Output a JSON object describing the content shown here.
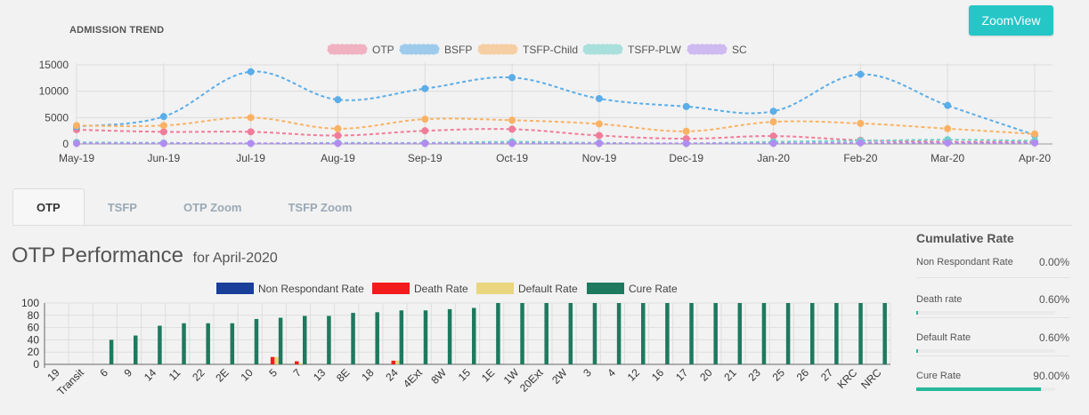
{
  "header": {
    "trend_title": "ADMISSION TREND",
    "zoom_button": "ZoomView"
  },
  "chart_data": [
    {
      "type": "line",
      "title": "ADMISSION TREND",
      "categories": [
        "May-19",
        "Jun-19",
        "Jul-19",
        "Aug-19",
        "Sep-19",
        "Oct-19",
        "Nov-19",
        "Dec-19",
        "Jan-20",
        "Feb-20",
        "Mar-20",
        "Apr-20"
      ],
      "ylim": [
        0,
        15000
      ],
      "yticks": [
        0,
        5000,
        10000,
        15000
      ],
      "legend_position": "top",
      "grid": true,
      "series": [
        {
          "name": "OTP",
          "color": "#f07c9a",
          "values": [
            2700,
            2300,
            2300,
            1600,
            2500,
            2800,
            1600,
            1000,
            1500,
            700,
            400,
            400
          ]
        },
        {
          "name": "BSFP",
          "color": "#5aade8",
          "values": [
            3300,
            5200,
            13700,
            8400,
            10500,
            12600,
            8600,
            7100,
            6200,
            13200,
            7300,
            1700
          ]
        },
        {
          "name": "TSFP-Child",
          "color": "#f9b264",
          "values": [
            3500,
            3500,
            5000,
            2900,
            4700,
            4500,
            3800,
            2400,
            4200,
            3900,
            2900,
            1900
          ]
        },
        {
          "name": "TSFP-PLW",
          "color": "#6fd0cb",
          "values": [
            300,
            200,
            100,
            200,
            200,
            400,
            200,
            100,
            400,
            600,
            800,
            600
          ]
        },
        {
          "name": "SC",
          "color": "#b18cf0",
          "values": [
            100,
            100,
            100,
            100,
            100,
            100,
            100,
            100,
            100,
            200,
            200,
            200
          ]
        }
      ]
    },
    {
      "type": "bar",
      "categories": [
        "19",
        "Transit",
        "6",
        "9",
        "14",
        "11",
        "22",
        "2E",
        "10",
        "5",
        "7",
        "13",
        "8E",
        "18",
        "24",
        "4Ext",
        "8W",
        "15",
        "1E",
        "1W",
        "20Ext",
        "2W",
        "3",
        "4",
        "12",
        "16",
        "17",
        "20",
        "21",
        "23",
        "25",
        "26",
        "27",
        "KRC",
        "NRC"
      ],
      "ylim": [
        0,
        100
      ],
      "yticks": [
        0,
        20,
        40,
        60,
        80,
        100
      ],
      "legend_position": "top",
      "series": [
        {
          "name": "Non Respondant Rate",
          "color": "#1a3f9a",
          "values": [
            0,
            0,
            0,
            0,
            0,
            0,
            0,
            0,
            0,
            0,
            0,
            0,
            0,
            0,
            0,
            0,
            0,
            0,
            0,
            0,
            0,
            0,
            0,
            0,
            0,
            0,
            0,
            0,
            0,
            0,
            0,
            0,
            0,
            0,
            0
          ]
        },
        {
          "name": "Death Rate",
          "color": "#f21c1c",
          "values": [
            0,
            0,
            0,
            0,
            0,
            0,
            0,
            0,
            0,
            12,
            5,
            0,
            0,
            0,
            6,
            0,
            0,
            0,
            0,
            0,
            0,
            0,
            0,
            0,
            0,
            0,
            0,
            0,
            0,
            0,
            0,
            0,
            0,
            0,
            0
          ]
        },
        {
          "name": "Default Rate",
          "color": "#e9d67f",
          "values": [
            0,
            0,
            0,
            0,
            0,
            0,
            0,
            0,
            0,
            12,
            2,
            0,
            0,
            0,
            6,
            0,
            0,
            0,
            0,
            0,
            0,
            0,
            0,
            0,
            0,
            0,
            0,
            0,
            0,
            0,
            0,
            0,
            0,
            0,
            0
          ]
        },
        {
          "name": "Cure Rate",
          "color": "#1d7a5e",
          "values": [
            0,
            0,
            40,
            47,
            63,
            67,
            67,
            67,
            74,
            76,
            79,
            79,
            84,
            85,
            88,
            88,
            90,
            92,
            100,
            100,
            100,
            100,
            100,
            100,
            100,
            100,
            100,
            100,
            100,
            100,
            100,
            100,
            100,
            100,
            100
          ]
        }
      ]
    }
  ],
  "tabs": [
    {
      "label": "OTP"
    },
    {
      "label": "TSFP"
    },
    {
      "label": "OTP Zoom"
    },
    {
      "label": "TSFP Zoom"
    }
  ],
  "performance": {
    "title": "OTP Performance",
    "subtitle": "for April-2020"
  },
  "cumulative": {
    "title": "Cumulative Rate",
    "rows": [
      {
        "label": "Non Respondant Rate",
        "value": "0.00%",
        "fraction": 0.0
      },
      {
        "label": "Death rate",
        "value": "0.60%",
        "fraction": 0.006
      },
      {
        "label": "Default Rate",
        "value": "0.60%",
        "fraction": 0.006
      },
      {
        "label": "Cure Rate",
        "value": "90.00%",
        "fraction": 0.9
      }
    ]
  }
}
